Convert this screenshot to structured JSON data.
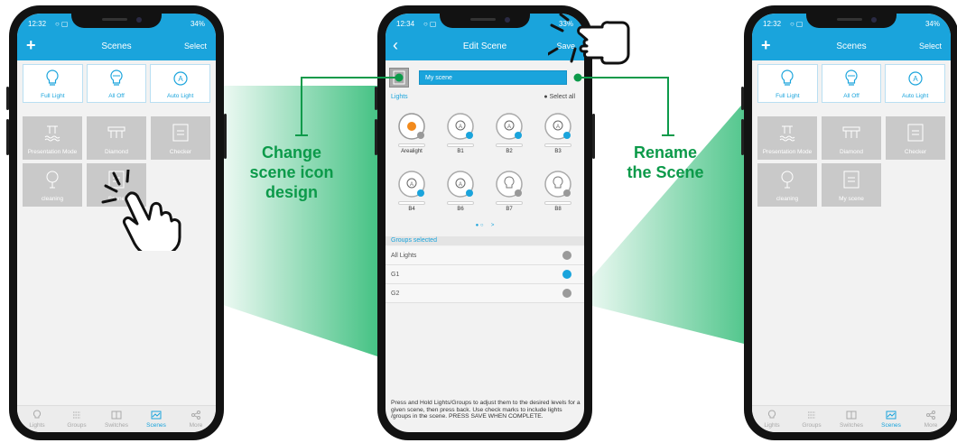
{
  "colors": {
    "accent": "#1aa4dc",
    "annotation": "#0c9a4a",
    "beam": "#3cbf7e",
    "scene_card": "#c9c9c9"
  },
  "phone_left": {
    "status": {
      "time": "12:32",
      "battery": "34%"
    },
    "appbar": {
      "add_icon": "plus-icon",
      "title": "Scenes",
      "select_label": "Select"
    },
    "quick_scenes": [
      {
        "label": "Full Light",
        "icon": "bulb-icon"
      },
      {
        "label": "All Off",
        "icon": "bulb-off-icon"
      },
      {
        "label": "Auto Light",
        "icon": "auto-icon"
      }
    ],
    "scenes": [
      {
        "label": "Presentation Mode",
        "icon": "presentation-icon"
      },
      {
        "label": "Diamond",
        "icon": "diamond-icon"
      },
      {
        "label": "Checker",
        "icon": "checker-icon"
      },
      {
        "label": "cleaning",
        "icon": "cleaning-icon"
      },
      {
        "label": "Scene",
        "icon": "scene-icon"
      }
    ],
    "nav": [
      {
        "label": "Lights",
        "icon": "bulb-icon"
      },
      {
        "label": "Groups",
        "icon": "groups-icon"
      },
      {
        "label": "Switches",
        "icon": "switch-icon"
      },
      {
        "label": "Scenes",
        "icon": "scenes-icon",
        "active": true
      },
      {
        "label": "More",
        "icon": "share-icon"
      }
    ]
  },
  "phone_middle": {
    "status": {
      "time": "12:34",
      "battery": "33%"
    },
    "appbar": {
      "back_icon": "back-arrow-icon",
      "title": "Edit Scene",
      "save_label": "Save"
    },
    "scene_name": "My scene",
    "lights_label": "Lights",
    "select_all_label": "Select all",
    "lights": [
      {
        "name": "Arealight",
        "selected": false,
        "type": "area"
      },
      {
        "name": "B1",
        "selected": true,
        "type": "auto"
      },
      {
        "name": "B2",
        "selected": true,
        "type": "auto"
      },
      {
        "name": "B3",
        "selected": true,
        "type": "auto"
      },
      {
        "name": "B4",
        "selected": true,
        "type": "auto"
      },
      {
        "name": "B6",
        "selected": true,
        "type": "auto"
      },
      {
        "name": "B7",
        "selected": false,
        "type": "bulb"
      },
      {
        "name": "B8",
        "selected": false,
        "type": "bulb"
      }
    ],
    "pager_next": ">",
    "groups_label": "Groups selected",
    "groups": [
      {
        "name": "All Lights",
        "selected": false
      },
      {
        "name": "G1",
        "selected": true
      },
      {
        "name": "G2",
        "selected": false
      }
    ],
    "help_text": "Press and Hold Lights/Groups to adjust them to the desired levels for a given scene, then press back. Use check marks to include lights /groups in the scene. PRESS SAVE WHEN COMPLETE."
  },
  "phone_right": {
    "status": {
      "time": "12:32",
      "battery": "34%"
    },
    "appbar": {
      "add_icon": "plus-icon",
      "title": "Scenes",
      "select_label": "Select"
    },
    "quick_scenes": [
      {
        "label": "Full Light",
        "icon": "bulb-icon"
      },
      {
        "label": "All Off",
        "icon": "bulb-off-icon"
      },
      {
        "label": "Auto Light",
        "icon": "auto-icon"
      }
    ],
    "scenes": [
      {
        "label": "Presentation Mode",
        "icon": "presentation-icon"
      },
      {
        "label": "Diamond",
        "icon": "diamond-icon"
      },
      {
        "label": "Checker",
        "icon": "checker-icon"
      },
      {
        "label": "cleaning",
        "icon": "cleaning-icon"
      },
      {
        "label": "My scene",
        "icon": "checker-icon"
      }
    ],
    "nav": [
      {
        "label": "Lights",
        "icon": "bulb-icon"
      },
      {
        "label": "Groups",
        "icon": "groups-icon"
      },
      {
        "label": "Switches",
        "icon": "switch-icon"
      },
      {
        "label": "Scenes",
        "icon": "scenes-icon",
        "active": true
      },
      {
        "label": "More",
        "icon": "share-icon"
      }
    ]
  },
  "annotations": {
    "left": [
      "Change",
      "scene icon",
      "design"
    ],
    "right": [
      "Rename",
      "the Scene"
    ]
  }
}
